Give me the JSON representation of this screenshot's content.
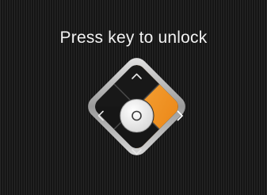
{
  "screen": {
    "prompt": "Press key to unlock"
  },
  "dpad": {
    "active_key": "right",
    "colors": {
      "active": "#f0921e",
      "key": "#161616",
      "rim": "#cfcfcf",
      "center": "#f4f4f4",
      "glyph": "#e6e6e6"
    },
    "keys": [
      {
        "id": "up",
        "icon": "chevron-up-icon"
      },
      {
        "id": "left",
        "icon": "chevron-left-icon"
      },
      {
        "id": "ok",
        "icon": "circle-icon"
      },
      {
        "id": "right",
        "icon": "chevron-right-icon"
      },
      {
        "id": "down",
        "icon": "chevron-down-icon"
      }
    ]
  }
}
